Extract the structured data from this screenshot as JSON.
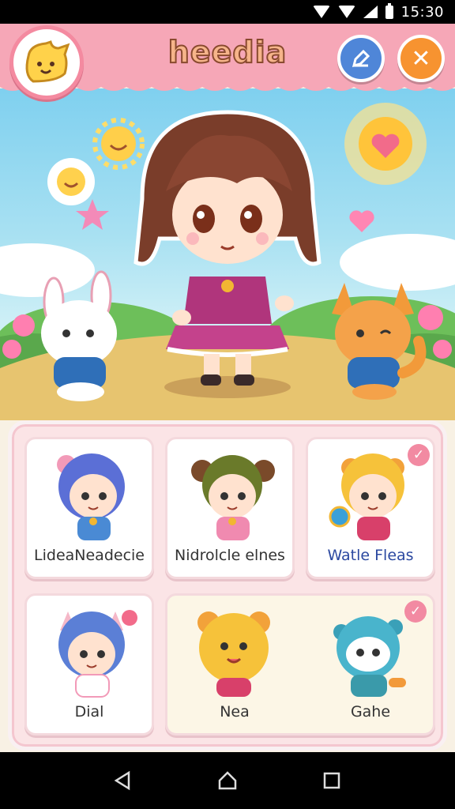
{
  "status_bar": {
    "time": "15:30"
  },
  "header": {
    "title": "heedia",
    "edit_icon": "pencil-icon",
    "close_icon": "close-icon",
    "colors": {
      "bar": "#f6a7b7",
      "edit": "#4f86d8",
      "close": "#f79330"
    }
  },
  "scene": {
    "main_character": "girl-character",
    "companions": [
      "bunny-character",
      "fox-character"
    ],
    "decor": [
      "sun-icon",
      "flower-sun-icon",
      "star-icon",
      "heart-sun-icon",
      "heart-balloon-icon"
    ]
  },
  "characters": [
    {
      "label": "LideaNeadecie",
      "avatar": "blue-hair-girl-avatar",
      "label_color": "default",
      "selected": false
    },
    {
      "label": "Nidrolcle elnes",
      "avatar": "bear-ear-boy-avatar",
      "label_color": "default",
      "selected": false
    },
    {
      "label": "Watle Fleas",
      "avatar": "blonde-bear-girl-avatar",
      "label_color": "blue",
      "selected": true
    },
    {
      "label": "Dial",
      "avatar": "cat-ear-girl-avatar",
      "label_color": "default",
      "selected": false
    },
    {
      "label": "Nea",
      "avatar": "yellow-bear-avatar",
      "label_color": "default",
      "selected": false
    },
    {
      "label": "Gahe",
      "avatar": "teal-creature-avatar",
      "label_color": "default",
      "selected": true
    }
  ],
  "nav": {
    "back": "back-icon",
    "home": "home-icon",
    "recents": "recents-icon"
  }
}
